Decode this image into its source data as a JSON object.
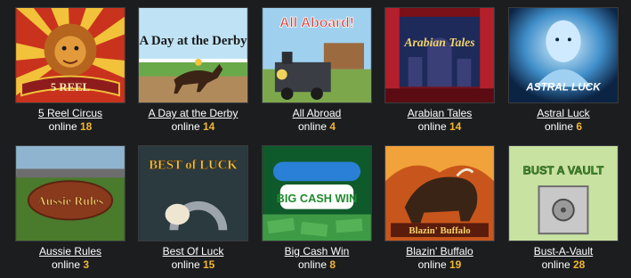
{
  "online_label": "online",
  "games": [
    {
      "name": "5 Reel Circus",
      "online": "18",
      "art_text": "5 REEL"
    },
    {
      "name": "A Day at the Derby",
      "online": "14",
      "art_text": "A Day at the Derby"
    },
    {
      "name": "All Abroad",
      "online": "4",
      "art_text": "All Aboard!"
    },
    {
      "name": "Arabian Tales",
      "online": "14",
      "art_text": "Arabian Tales"
    },
    {
      "name": "Astral Luck",
      "online": "6",
      "art_text": "ASTRAL LUCK"
    },
    {
      "name": "Aussie Rules",
      "online": "3",
      "art_text": "Aussie Rules"
    },
    {
      "name": "Best Of Luck",
      "online": "15",
      "art_text": "BEST of LUCK"
    },
    {
      "name": "Big Cash Win",
      "online": "8",
      "art_text": "BIG CASH WIN"
    },
    {
      "name": "Blazin' Buffalo",
      "online": "19",
      "art_text": "Blazin' Buffalo"
    },
    {
      "name": "Bust-A-Vault",
      "online": "28",
      "art_text": "BUST A VAULT"
    }
  ],
  "colors": {
    "background": "#1c1d1f",
    "link_text": "#ffffff",
    "online_count": "#f2b632"
  }
}
